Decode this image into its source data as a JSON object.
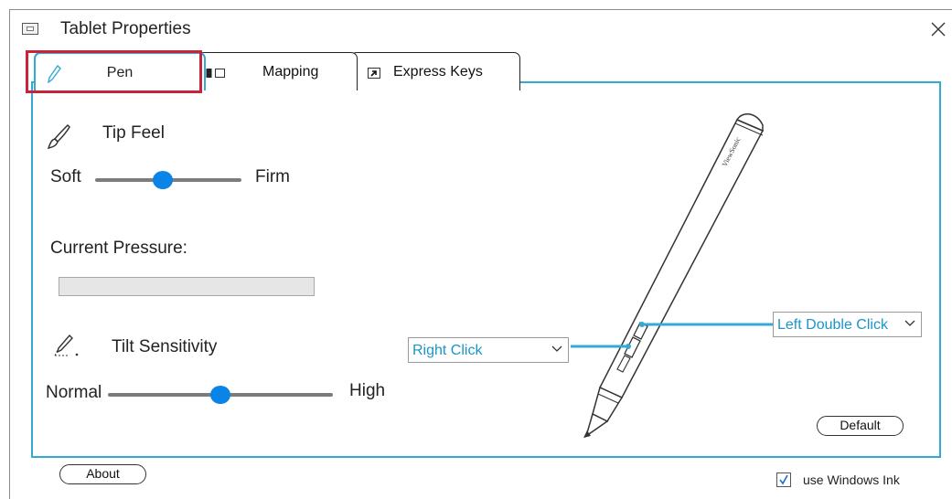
{
  "window": {
    "title": "Tablet Properties"
  },
  "tabs": [
    {
      "label": "Pen",
      "icon": "pen-icon",
      "active": true
    },
    {
      "label": "Mapping",
      "icon": "mapping-icon",
      "active": false
    },
    {
      "label": "Express Keys",
      "icon": "express-keys-icon",
      "active": false
    }
  ],
  "tip_feel": {
    "title": "Tip Feel",
    "min_label": "Soft",
    "max_label": "Firm",
    "value_fraction": 0.46
  },
  "pressure": {
    "label": "Current Pressure:",
    "value_fraction": 0
  },
  "tilt": {
    "title": "Tilt Sensitivity",
    "min_label": "Normal",
    "max_label": "High",
    "value_fraction": 0.5
  },
  "pen_buttons": {
    "lower_button": "Right Click",
    "upper_button": "Left Double Click"
  },
  "pen_brand": "ViewSonic",
  "buttons": {
    "default_label": "Default",
    "about_label": "About"
  },
  "windows_ink": {
    "label": "use Windows Ink",
    "checked": true
  },
  "colors": {
    "accent": "#34a9d6",
    "slider_thumb": "#0a84e6",
    "highlight": "#c8233a"
  }
}
